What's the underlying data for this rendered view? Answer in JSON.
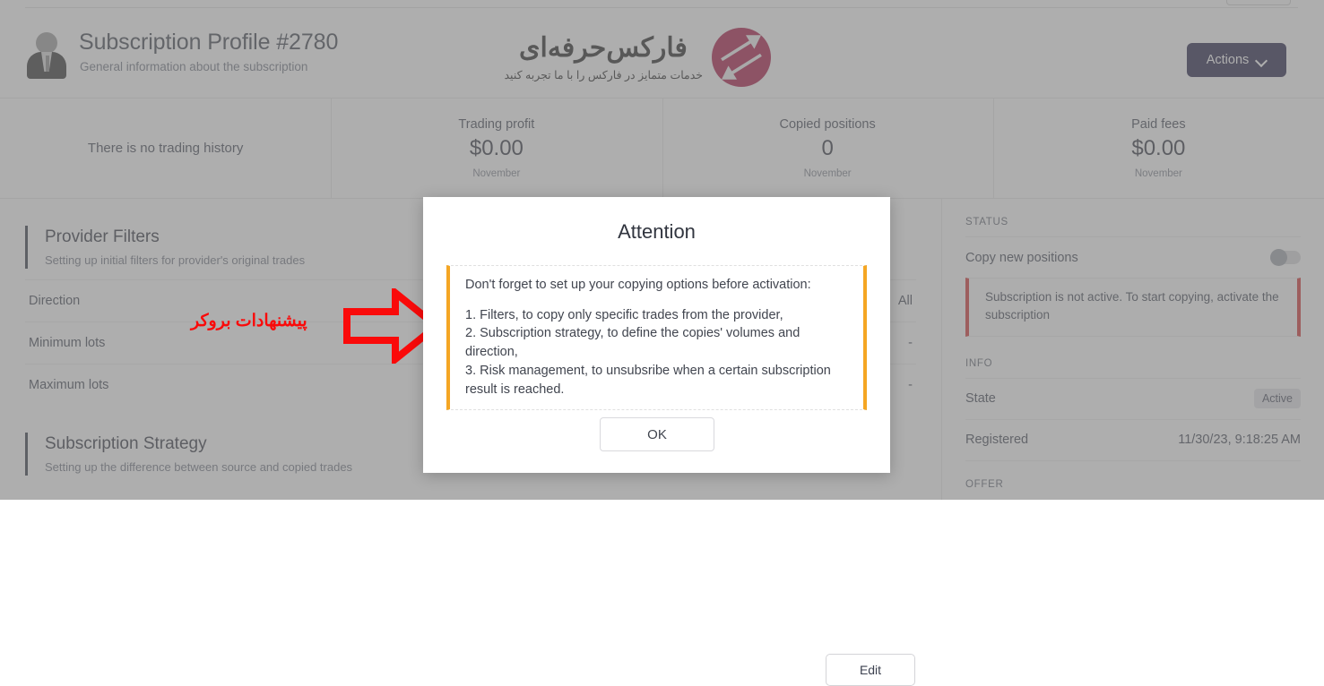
{
  "header": {
    "title": "Subscription Profile #2780",
    "subtitle": "General information about the subscription",
    "avatar_icon": "user-avatar-icon",
    "actions_label": "Actions",
    "chevron_icon": "chevron-down-icon",
    "brand": {
      "name": "فارکس‌حرفه‌ای",
      "slogan": "خدمات متمایز در فارکس را با ما تجربه کنید",
      "mark_icon": "swap-arrows-logo-icon",
      "mark_color": "#a81141"
    }
  },
  "stats": {
    "empty_message": "There is no trading history",
    "cards": [
      {
        "label": "Trading profit",
        "value": "$0.00",
        "period": "November"
      },
      {
        "label": "Copied positions",
        "value": "0",
        "period": "November"
      },
      {
        "label": "Paid fees",
        "value": "$0.00",
        "period": "November"
      }
    ]
  },
  "provider_filters": {
    "title": "Provider Filters",
    "subtitle": "Setting up initial filters for provider's original trades",
    "rows": [
      {
        "label": "Direction",
        "value": "All"
      },
      {
        "label": "Minimum lots",
        "value": "-"
      },
      {
        "label": "Maximum lots",
        "value": "-"
      }
    ]
  },
  "subscription_strategy": {
    "title": "Subscription Strategy",
    "subtitle": "Setting up the difference between source and copied trades",
    "edit_label": "Edit"
  },
  "sidebar": {
    "status_heading": "STATUS",
    "copy_positions_label": "Copy new positions",
    "copy_positions_toggle": "off",
    "alert_text": "Subscription is not active. To start copying, activate the subscription",
    "alert_color": "#d32f2f",
    "info_heading": "INFO",
    "info_rows": [
      {
        "label": "State",
        "value": "Active",
        "badge": true
      },
      {
        "label": "Registered",
        "value": "11/30/23, 9:18:25 AM",
        "badge": false
      }
    ],
    "offer_heading": "OFFER"
  },
  "modal": {
    "title": "Attention",
    "intro": "Don't forget to set up your copying options before activation:",
    "items": [
      "1. Filters, to copy only specific trades from the provider,",
      "2. Subscription strategy, to define the copies' volumes and direction,",
      "3. Risk management, to unsubsribe when a certain subscription result is reached."
    ],
    "ok_label": "OK",
    "accent_color": "#f5a623"
  },
  "annotation": {
    "text": "پیشنهادات بروکر",
    "arrow_icon": "right-arrow-annotation-icon",
    "color": "#fa0a0a"
  }
}
